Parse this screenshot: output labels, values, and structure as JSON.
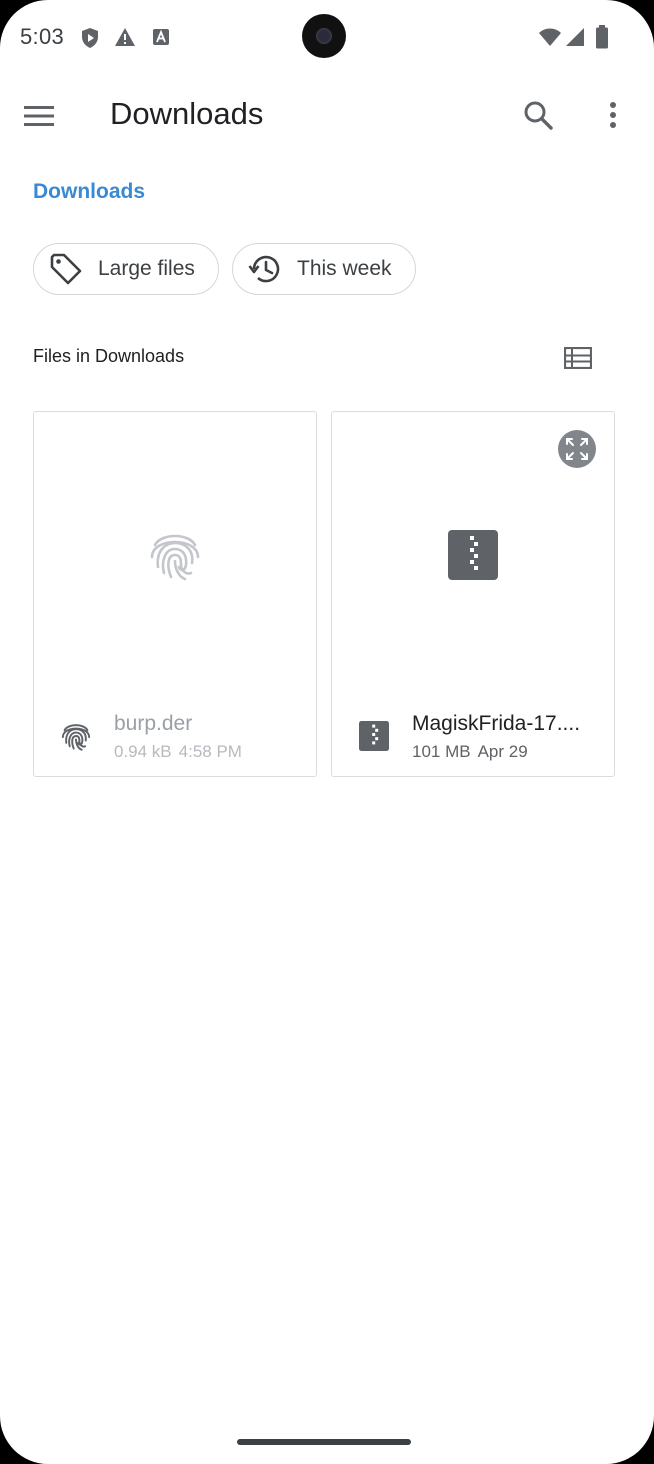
{
  "status_bar": {
    "time": "5:03",
    "left_icons": [
      "shield-play-icon",
      "warning-icon",
      "font-a-icon"
    ],
    "right_icons": [
      "wifi-icon",
      "cell-signal-icon",
      "battery-icon"
    ]
  },
  "app_bar": {
    "title": "Downloads",
    "menu_icon": "hamburger-menu-icon",
    "search_icon": "search-icon",
    "more_icon": "more-vert-icon"
  },
  "breadcrumb": {
    "label": "Downloads"
  },
  "chips": [
    {
      "label": "Large files",
      "icon": "tag-icon"
    },
    {
      "label": "This week",
      "icon": "history-icon"
    }
  ],
  "section": {
    "title": "Files in Downloads",
    "view_toggle_icon": "list-view-icon"
  },
  "files": [
    {
      "name": "burp.der",
      "size": "0.94 kB",
      "date": "4:58 PM",
      "icon": "fingerprint-icon",
      "dimmed": true
    },
    {
      "name": "MagiskFrida-17....",
      "size": "101 MB",
      "date": "Apr 29",
      "icon": "zip-archive-icon",
      "dimmed": false,
      "expand_icon": "expand-icon"
    }
  ],
  "colors": {
    "accent": "#3a8ad3",
    "icon_grey": "#5f6368",
    "border": "#dadce0",
    "text": "#202124"
  }
}
